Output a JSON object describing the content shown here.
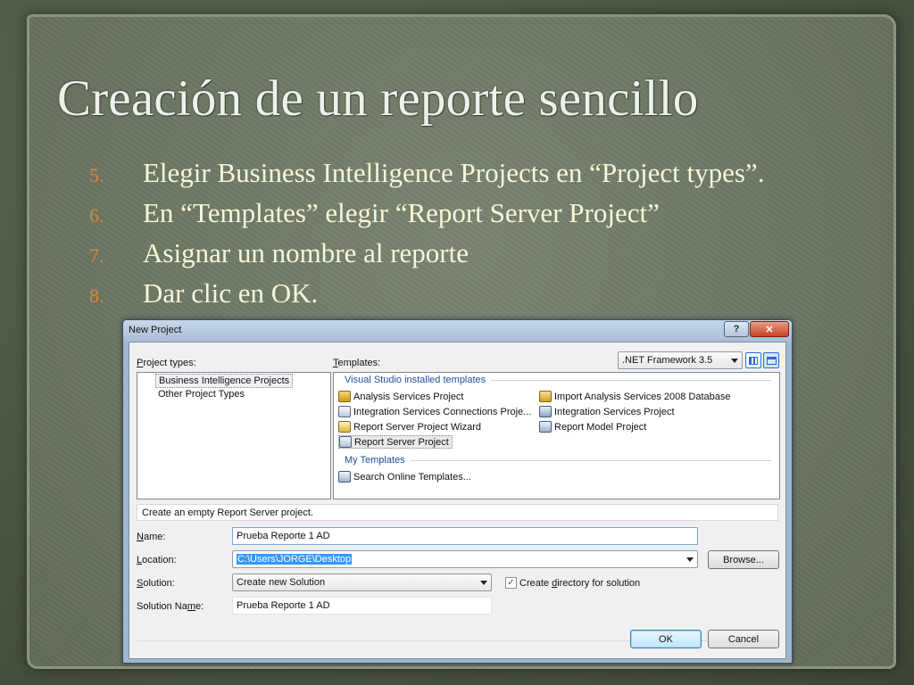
{
  "slide": {
    "title": "Creación de un reporte sencillo",
    "steps": [
      {
        "num": "5.",
        "text": "Elegir Business Intelligence Projects en “Project types”."
      },
      {
        "num": "6.",
        "text": "En “Templates” elegir “Report Server Project”"
      },
      {
        "num": "7.",
        "text": "Asignar un nombre al reporte"
      },
      {
        "num": "8.",
        "text": "Dar clic en OK."
      }
    ],
    "colors": {
      "title": "#eef0ea",
      "step_text": "#f8f6d6",
      "step_num": "#d7883c",
      "background": "#6f7967"
    }
  },
  "dialog": {
    "title": "New Project",
    "help_label": "?",
    "close_label": "✕",
    "project_types_label_u": "P",
    "project_types_label_rest": "roject types:",
    "templates_label_u": "T",
    "templates_label_rest": "emplates:",
    "framework": ".NET Framework 3.5",
    "project_types": [
      "Business Intelligence Projects",
      "Other Project Types"
    ],
    "groups": {
      "installed": "Visual Studio installed templates",
      "my": "My Templates"
    },
    "templates": {
      "analysis": "Analysis Services Project",
      "integration_conn": "Integration Services Connections Proje...",
      "report_wizard": "Report Server Project Wizard",
      "report_server": "Report Server Project",
      "import_analysis": "Import Analysis Services 2008 Database",
      "integration": "Integration Services Project",
      "report_model": "Report Model Project",
      "search_online": "Search Online Templates..."
    },
    "description": "Create an empty Report Server project.",
    "name_label_u": "N",
    "name_label_rest": "ame:",
    "name_value": "Prueba Reporte 1 AD",
    "location_label_u": "L",
    "location_label_rest": "ocation:",
    "location_value": "C:\\Users\\JORGE\\Desktop",
    "browse_label": "Browse...",
    "solution_label_u": "S",
    "solution_label_rest": "olution:",
    "solution_value": "Create new Solution",
    "create_dir_pre": "Create ",
    "create_dir_u": "d",
    "create_dir_rest": "irectory for solution",
    "create_dir_checked": "✓",
    "solution_name_label_pre": "Solution Na",
    "solution_name_label_u": "m",
    "solution_name_label_rest": "e:",
    "solution_name_value": "Prueba Reporte 1 AD",
    "ok_label": "OK",
    "cancel_label": "Cancel"
  }
}
